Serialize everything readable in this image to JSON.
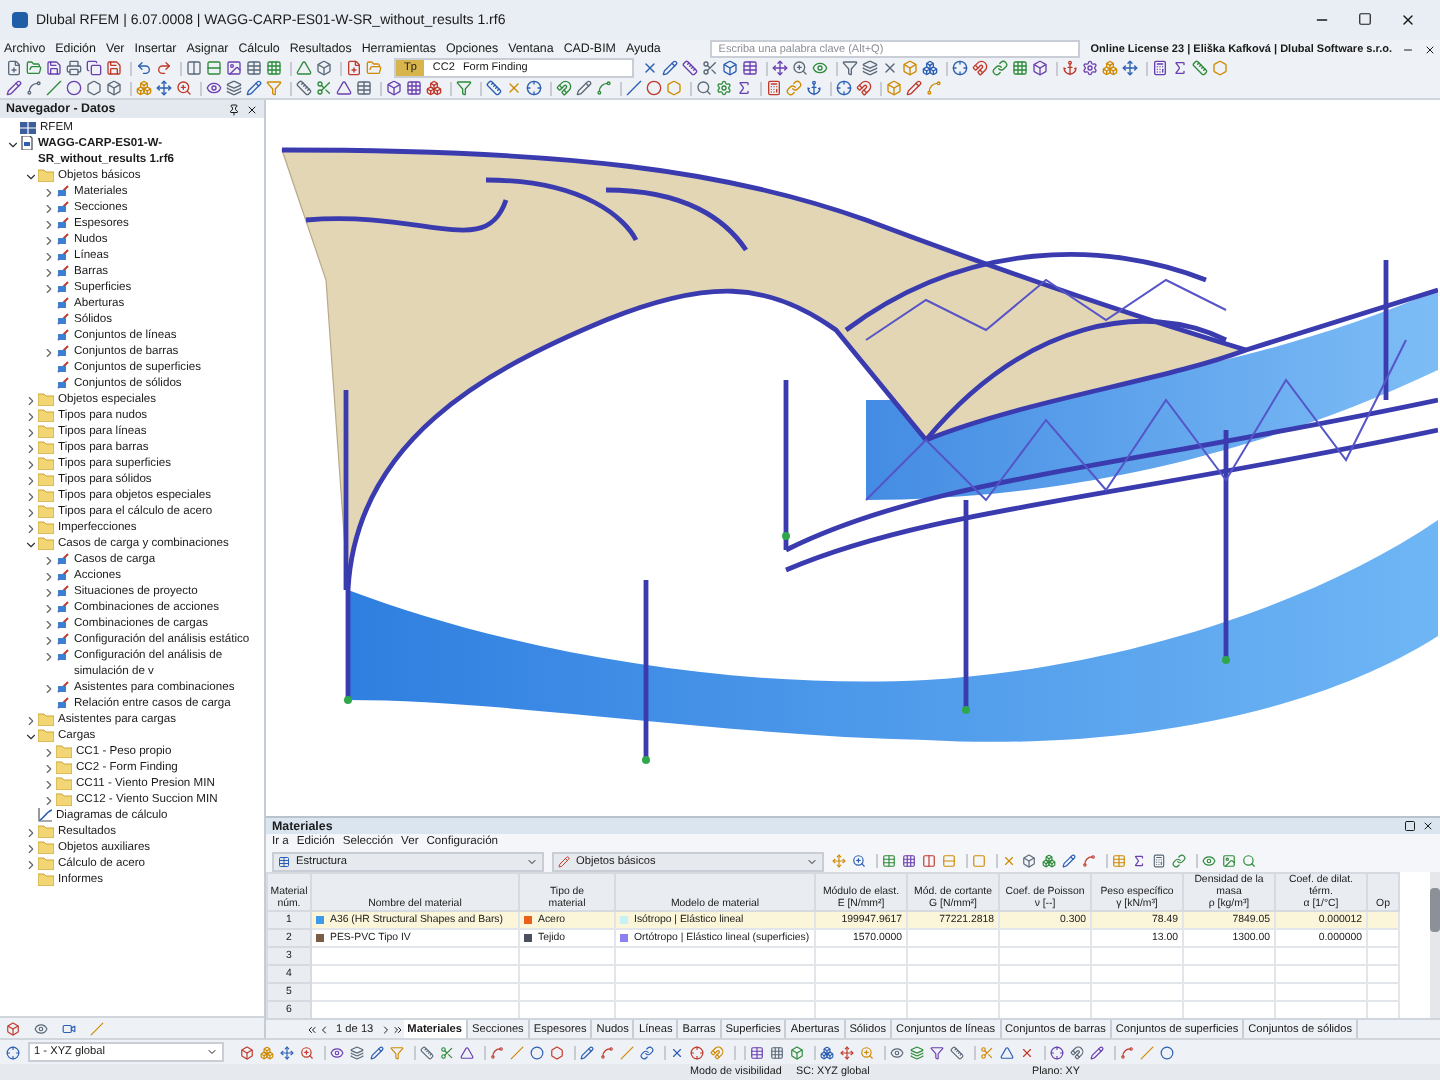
{
  "window": {
    "title": "Dlubal RFEM | 6.07.0008 | WAGG-CARP-ES01-W-SR_without_results 1.rf6"
  },
  "menu": [
    "Archivo",
    "Edición",
    "Ver",
    "Insertar",
    "Asignar",
    "Cálculo",
    "Resultados",
    "Herramientas",
    "Opciones",
    "Ventana",
    "CAD-BIM",
    "Ayuda"
  ],
  "search": {
    "placeholder": "Escriba una palabra clave (Alt+Q)"
  },
  "license": "Online License 23 | Eliška Kafková | Dlubal Software s.r.o.",
  "load_case": {
    "badge": "Tp",
    "code": "CC2",
    "name": "Form Finding"
  },
  "navigator": {
    "title": "Navegador - Datos",
    "tree": [
      {
        "label": "RFEM",
        "kind": "root"
      },
      {
        "label": "WAGG-CARP-ES01-W-SR_without_results 1.rf6",
        "kind": "file",
        "expanded": true,
        "children": [
          {
            "label": "Objetos básicos",
            "kind": "folder",
            "expanded": true,
            "children": [
              {
                "label": "Materiales",
                "kind": "item",
                "expanded": false
              },
              {
                "label": "Secciones",
                "kind": "item",
                "expanded": false
              },
              {
                "label": "Espesores",
                "kind": "item",
                "expanded": false
              },
              {
                "label": "Nudos",
                "kind": "item",
                "expanded": false
              },
              {
                "label": "Líneas",
                "kind": "item",
                "expanded": false
              },
              {
                "label": "Barras",
                "kind": "item",
                "expanded": false
              },
              {
                "label": "Superficies",
                "kind": "item",
                "expanded": false
              },
              {
                "label": "Aberturas",
                "kind": "item"
              },
              {
                "label": "Sólidos",
                "kind": "item"
              },
              {
                "label": "Conjuntos de líneas",
                "kind": "item"
              },
              {
                "label": "Conjuntos de barras",
                "kind": "item",
                "expanded": false
              },
              {
                "label": "Conjuntos de superficies",
                "kind": "item"
              },
              {
                "label": "Conjuntos de sólidos",
                "kind": "item"
              }
            ]
          },
          {
            "label": "Objetos especiales",
            "kind": "folder",
            "expanded": false
          },
          {
            "label": "Tipos para nudos",
            "kind": "folder",
            "expanded": false
          },
          {
            "label": "Tipos para líneas",
            "kind": "folder",
            "expanded": false
          },
          {
            "label": "Tipos para barras",
            "kind": "folder",
            "expanded": false
          },
          {
            "label": "Tipos para superficies",
            "kind": "folder",
            "expanded": false
          },
          {
            "label": "Tipos para sólidos",
            "kind": "folder",
            "expanded": false
          },
          {
            "label": "Tipos para objetos especiales",
            "kind": "folder",
            "expanded": false
          },
          {
            "label": "Tipos para el cálculo de acero",
            "kind": "folder",
            "expanded": false
          },
          {
            "label": "Imperfecciones",
            "kind": "folder",
            "expanded": false
          },
          {
            "label": "Casos de carga y combinaciones",
            "kind": "folder",
            "expanded": true,
            "children": [
              {
                "label": "Casos de carga",
                "kind": "item",
                "expanded": false
              },
              {
                "label": "Acciones",
                "kind": "item",
                "expanded": false
              },
              {
                "label": "Situaciones de proyecto",
                "kind": "item",
                "expanded": false
              },
              {
                "label": "Combinaciones de acciones",
                "kind": "item",
                "expanded": false
              },
              {
                "label": "Combinaciones de cargas",
                "kind": "item",
                "expanded": false
              },
              {
                "label": "Configuración del análisis estático",
                "kind": "item",
                "expanded": false
              },
              {
                "label": "Configuración del análisis de simulación de v",
                "kind": "item",
                "expanded": false
              },
              {
                "label": "Asistentes para combinaciones",
                "kind": "item",
                "expanded": false
              },
              {
                "label": "Relación entre casos de carga",
                "kind": "item"
              }
            ]
          },
          {
            "label": "Asistentes para cargas",
            "kind": "folder",
            "expanded": false
          },
          {
            "label": "Cargas",
            "kind": "folder",
            "expanded": true,
            "children": [
              {
                "label": "CC1 - Peso propio",
                "kind": "folder",
                "expanded": false
              },
              {
                "label": "CC2 - Form Finding",
                "kind": "folder",
                "expanded": false
              },
              {
                "label": "CC11 - Viento Presion MIN",
                "kind": "folder",
                "expanded": false
              },
              {
                "label": "CC12 - Viento Succion MIN",
                "kind": "folder",
                "expanded": false
              }
            ]
          },
          {
            "label": "Diagramas de cálculo",
            "kind": "diagram"
          },
          {
            "label": "Resultados",
            "kind": "folder",
            "expanded": false
          },
          {
            "label": "Objetos auxiliares",
            "kind": "folder",
            "expanded": false
          },
          {
            "label": "Cálculo de acero",
            "kind": "folder",
            "expanded": false
          },
          {
            "label": "Informes",
            "kind": "folder"
          }
        ]
      }
    ]
  },
  "materials": {
    "title": "Materiales",
    "menu": [
      "Ir a",
      "Edición",
      "Selección",
      "Ver",
      "Configuración"
    ],
    "filter_1": "Estructura",
    "filter_2": "Objetos básicos",
    "columns": [
      {
        "line1": "Material",
        "line2": "núm."
      },
      {
        "line2": "Nombre del material"
      },
      {
        "line1": "Tipo de",
        "line2": "material"
      },
      {
        "line2": "Modelo de material"
      },
      {
        "line1": "Módulo de elast.",
        "line2": "E [N/mm²]"
      },
      {
        "line1": "Mód. de cortante",
        "line2": "G [N/mm²]"
      },
      {
        "line1": "Coef. de Poisson",
        "line2": "ν [--]"
      },
      {
        "line1": "Peso específico",
        "line2": "γ [kN/m³]"
      },
      {
        "line1": "Densidad de la masa",
        "line2": "ρ [kg/m³]"
      },
      {
        "line1": "Coef. de dilat. térm.",
        "line2": "α [1/°C]"
      },
      {
        "line1": "Op"
      }
    ],
    "rows": [
      {
        "number": "1",
        "selected": true,
        "name": {
          "label": "A36 (HR Structural Shapes and Bars)",
          "color": "#3d9be9"
        },
        "type": {
          "label": "Acero",
          "color": "#e8601c"
        },
        "model": {
          "label": "Isótropo | Elástico lineal",
          "color": "#c4f2f6"
        },
        "e": "199947.9617",
        "g": "77221.2818",
        "poisson": "0.300",
        "weight": "78.49",
        "density": "7849.05",
        "alpha": "0.000012"
      },
      {
        "number": "2",
        "selected": false,
        "name": {
          "label": "PES-PVC Tipo IV",
          "color": "#7a5c44"
        },
        "type": {
          "label": "Tejido",
          "color": "#4a5060"
        },
        "model": {
          "label": "Ortótropo | Elástico lineal (superficies)",
          "color": "#8a80f0"
        },
        "e": "1570.0000",
        "weight": "13.00",
        "density": "1300.00",
        "alpha": "0.000000"
      },
      {
        "number": "3"
      },
      {
        "number": "4"
      },
      {
        "number": "5"
      },
      {
        "number": "6"
      }
    ]
  },
  "bottom_tabs": {
    "pager": "1 de 13",
    "tabs": [
      {
        "label": "Materiales",
        "selected": true
      },
      {
        "label": "Secciones",
        "selected": false
      },
      {
        "label": "Espesores",
        "selected": false
      },
      {
        "label": "Nudos",
        "selected": false
      },
      {
        "label": "Líneas",
        "selected": false
      },
      {
        "label": "Barras",
        "selected": false
      },
      {
        "label": "Superficies",
        "selected": false
      },
      {
        "label": "Aberturas",
        "selected": false
      },
      {
        "label": "Sólidos",
        "selected": false
      },
      {
        "label": "Conjuntos de líneas",
        "selected": false
      },
      {
        "label": "Conjuntos de barras",
        "selected": false
      },
      {
        "label": "Conjuntos de superficies",
        "selected": false
      },
      {
        "label": "Conjuntos de sólidos",
        "selected": false
      }
    ]
  },
  "coordinate_system": "1 - XYZ global",
  "status_bar": [
    "Modo de visibilidad",
    "SC: XYZ global",
    "Plano: XY"
  ]
}
